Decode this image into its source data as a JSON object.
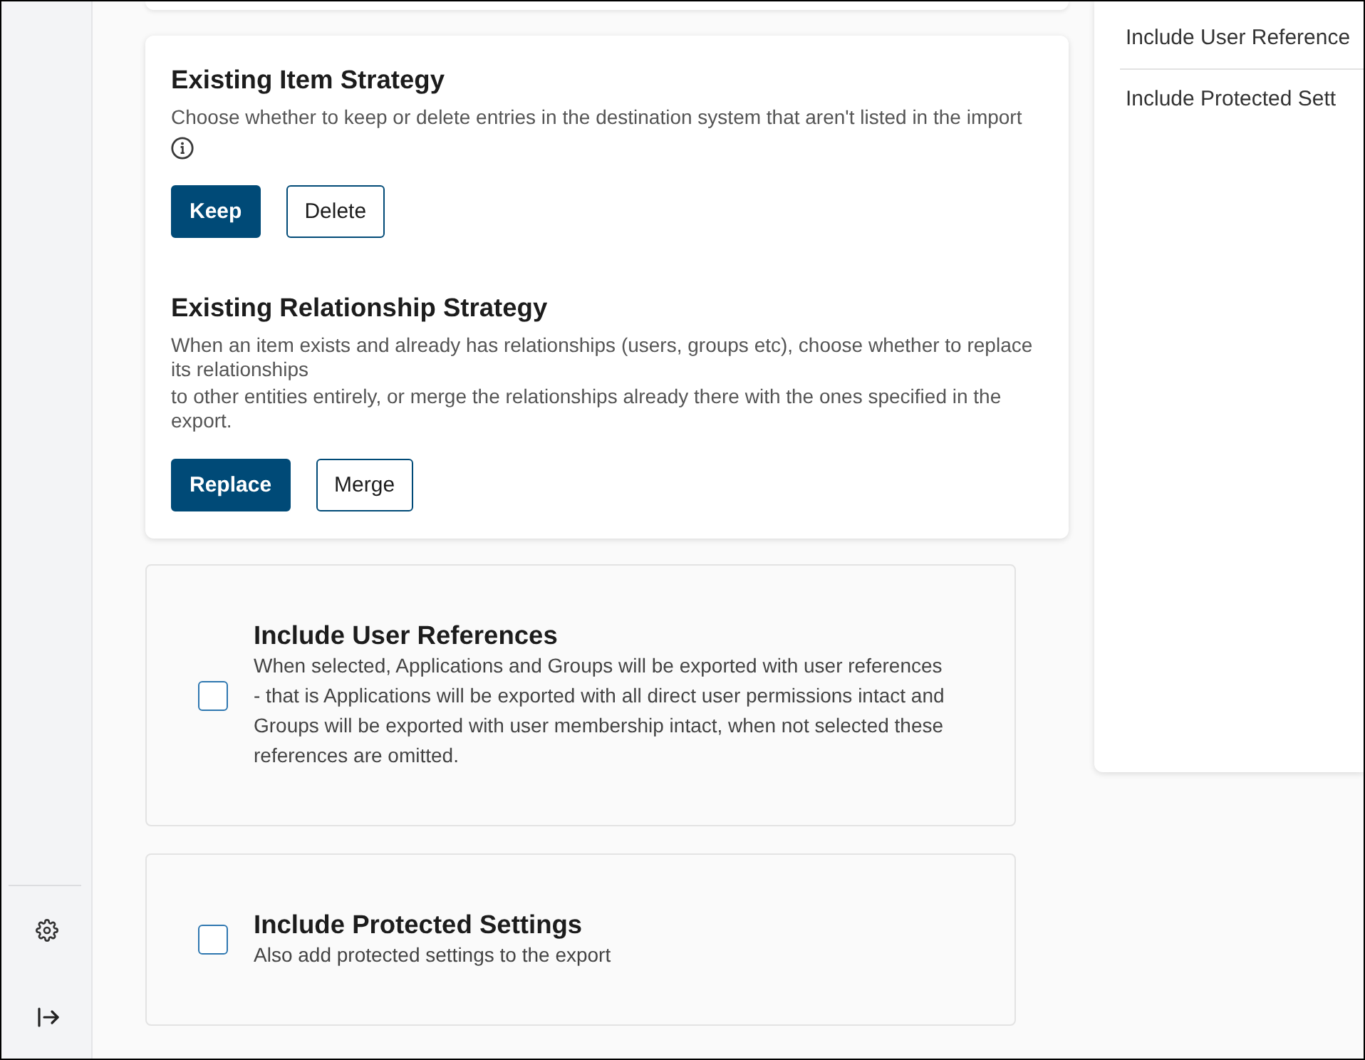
{
  "strategy_card": {
    "sections": [
      {
        "title": "Existing Item Strategy",
        "description": [
          "Choose whether to keep or delete entries in the destination system that aren't listed in the import"
        ],
        "info": true,
        "options": [
          {
            "label": "Keep",
            "selected": true
          },
          {
            "label": "Delete",
            "selected": false
          }
        ]
      },
      {
        "title": "Existing Relationship Strategy",
        "description": [
          "When an item exists and already has relationships (users, groups etc), choose whether to replace its relationships",
          "to other entities entirely, or merge the relationships already there with the ones specified in the export."
        ],
        "options": [
          {
            "label": "Replace",
            "selected": true
          },
          {
            "label": "Merge",
            "selected": false
          }
        ]
      }
    ]
  },
  "option_cards": [
    {
      "title": "Include User References",
      "description": "When selected, Applications and Groups will be exported with user references - that is Applications will be exported with all direct user permissions intact and Groups will be exported with user membership intact, when not selected these references are omitted.",
      "checked": false
    },
    {
      "title": "Include Protected Settings",
      "description": "Also add protected settings to the export",
      "checked": false
    }
  ],
  "side_panel": {
    "items": [
      {
        "label": "Include User Reference"
      },
      {
        "label": "Include Protected Sett"
      }
    ]
  }
}
